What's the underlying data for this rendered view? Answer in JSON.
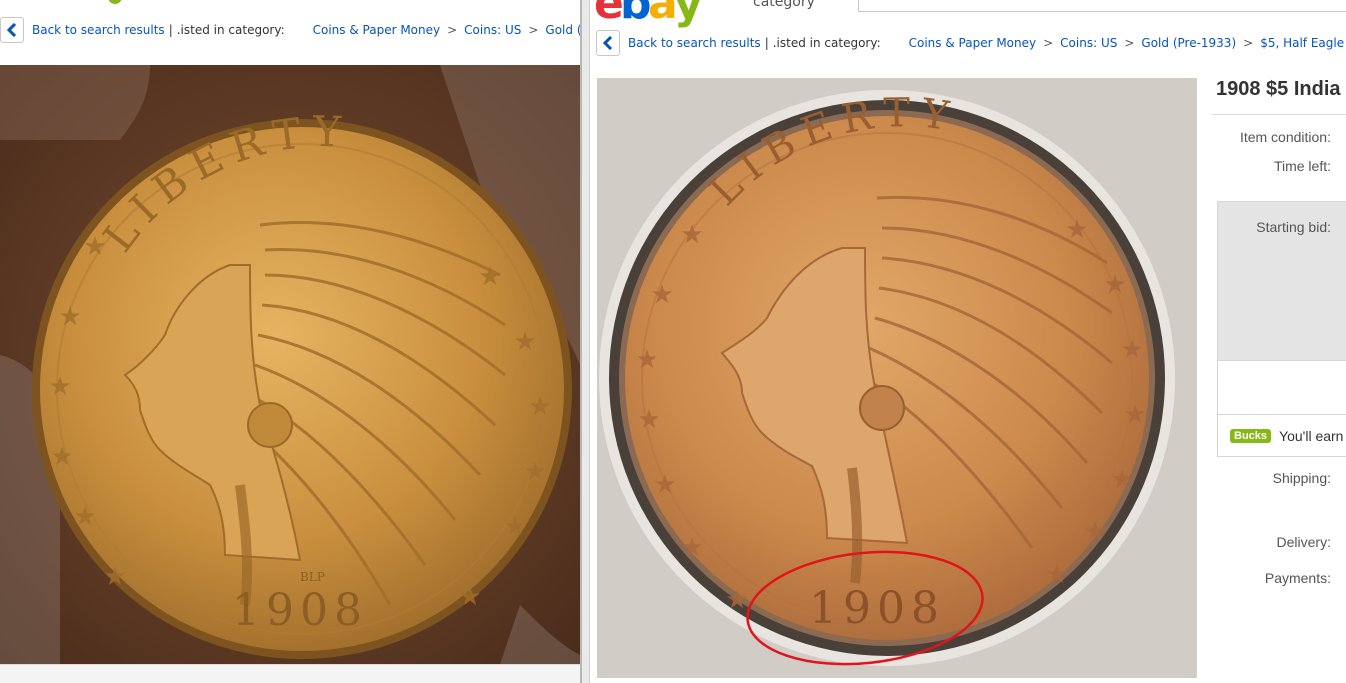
{
  "left_window": {
    "breadcrumb": {
      "back_label": "Back to search results",
      "divider": "|",
      "listed_in": ".isted in category:",
      "items": [
        "Coins & Paper Money",
        "Coins: US",
        "Gold (Pre"
      ],
      "separator": ">"
    },
    "photo": {
      "legend_text": "LIBERTY",
      "year": "1908",
      "initials": "BLP"
    }
  },
  "right_window": {
    "logo": {
      "letters": [
        "e",
        "b",
        "a",
        "y"
      ],
      "colors": [
        "#e53238",
        "#0064d2",
        "#f5af02",
        "#86b817"
      ]
    },
    "category_label": "category",
    "breadcrumb": {
      "back_label": "Back to search results",
      "divider": "|",
      "listed_in": ".isted in category:",
      "items": [
        "Coins & Paper Money",
        "Coins: US",
        "Gold (Pre-1933)",
        "$5, Half Eagle"
      ],
      "separator": ">"
    },
    "photo": {
      "legend_text": "LIBERTY",
      "year": "1908"
    },
    "item": {
      "title": "1908 $5 India",
      "item_condition_label": "Item condition:",
      "time_left_label": "Time left:",
      "starting_bid_label": "Starting bid:",
      "bucks_badge": "Bucks",
      "bucks_text": "You'll earn",
      "shipping_label": "Shipping:",
      "delivery_label": "Delivery:",
      "payments_label": "Payments:"
    }
  },
  "colors": {
    "link": "#0654ba",
    "bucks_green": "#86b817",
    "red_annotation": "#e3131b",
    "gold": "#c98f3e"
  }
}
